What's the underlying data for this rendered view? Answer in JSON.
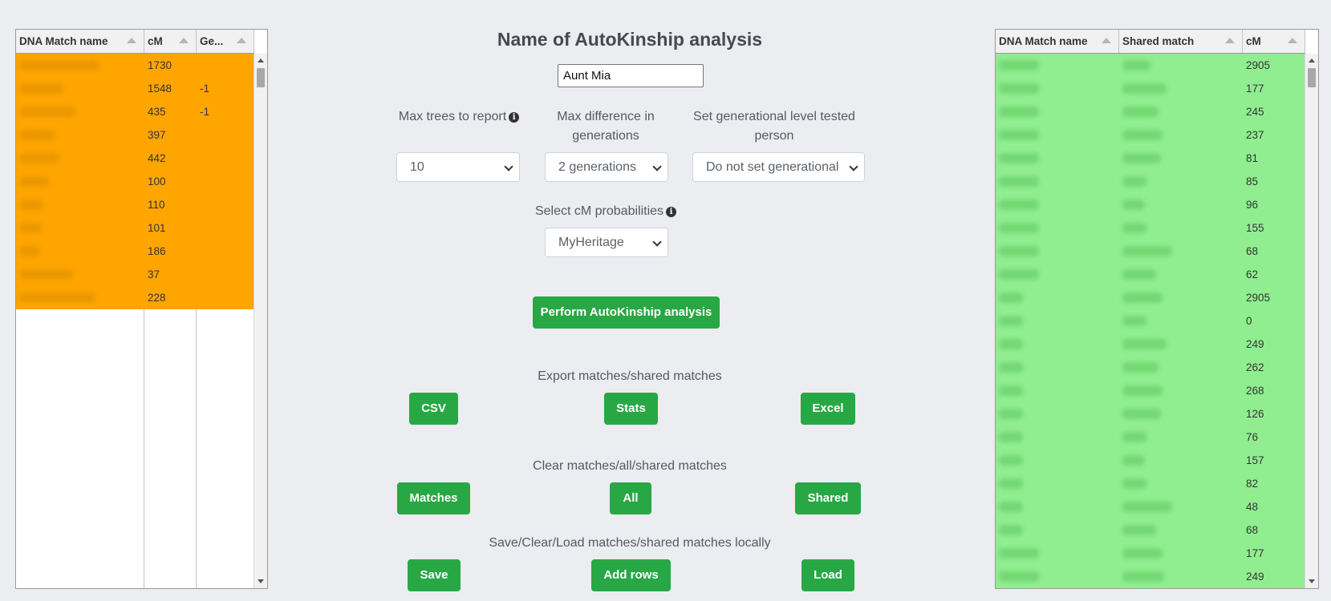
{
  "left_grid": {
    "columns": [
      "DNA Match name",
      "cM",
      "Ge..."
    ],
    "rows": [
      {
        "cM": "1730",
        "gen": ""
      },
      {
        "cM": "1548",
        "gen": "-1"
      },
      {
        "cM": "435",
        "gen": "-1"
      },
      {
        "cM": "397",
        "gen": ""
      },
      {
        "cM": "442",
        "gen": ""
      },
      {
        "cM": "100",
        "gen": ""
      },
      {
        "cM": "110",
        "gen": ""
      },
      {
        "cM": "101",
        "gen": ""
      },
      {
        "cM": "186",
        "gen": ""
      },
      {
        "cM": "37",
        "gen": ""
      },
      {
        "cM": "228",
        "gen": ""
      }
    ],
    "highlight_color": "#ffa500"
  },
  "right_grid": {
    "columns": [
      "DNA Match name",
      "Shared match",
      "cM"
    ],
    "rows": [
      {
        "cM": "2905"
      },
      {
        "cM": "177"
      },
      {
        "cM": "245"
      },
      {
        "cM": "237"
      },
      {
        "cM": "81"
      },
      {
        "cM": "85"
      },
      {
        "cM": "96"
      },
      {
        "cM": "155"
      },
      {
        "cM": "68"
      },
      {
        "cM": "62"
      },
      {
        "cM": "2905"
      },
      {
        "cM": "0"
      },
      {
        "cM": "249"
      },
      {
        "cM": "262"
      },
      {
        "cM": "268"
      },
      {
        "cM": "126"
      },
      {
        "cM": "76"
      },
      {
        "cM": "157"
      },
      {
        "cM": "82"
      },
      {
        "cM": "48"
      },
      {
        "cM": "68"
      },
      {
        "cM": "177"
      },
      {
        "cM": "249"
      }
    ],
    "highlight_color": "#90ee90"
  },
  "analysis": {
    "title": "Name of AutoKinship analysis",
    "name_value": "Aunt Mia",
    "max_trees_label": "Max trees to report",
    "max_trees_value": "10",
    "max_diff_label": "Max difference in generations",
    "max_diff_value": "2 generations",
    "gen_level_label": "Set generational level tested person",
    "gen_level_value": "Do not set generational",
    "cm_prob_label": "Select cM probabilities",
    "cm_prob_value": "MyHeritage",
    "perform_label": "Perform AutoKinship analysis"
  },
  "export": {
    "label": "Export matches/shared matches",
    "csv": "CSV",
    "stats": "Stats",
    "excel": "Excel"
  },
  "clear": {
    "label": "Clear matches/all/shared matches",
    "matches": "Matches",
    "all": "All",
    "shared": "Shared"
  },
  "local": {
    "label": "Save/Clear/Load matches/shared matches locally",
    "save": "Save",
    "add_rows": "Add rows",
    "load": "Load"
  },
  "colors": {
    "button_green": "#28a745",
    "background": "#ebedf0"
  }
}
